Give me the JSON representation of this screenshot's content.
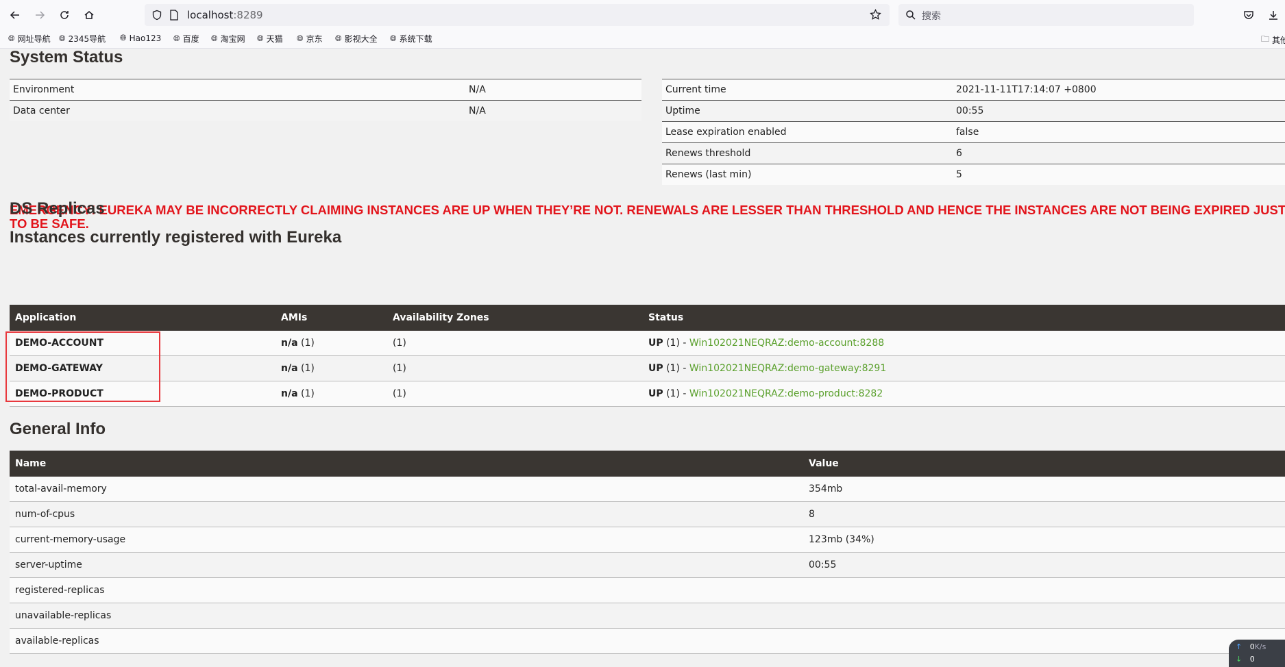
{
  "browser": {
    "url_host": "localhost",
    "url_port": ":8289",
    "search_placeholder": "搜索",
    "bookmarks": [
      "网址导航",
      "2345导航",
      "Hao123",
      "百度",
      "淘宝网",
      "天猫",
      "京东",
      "影视大全",
      "系统下载"
    ],
    "other_bookmarks": "其他"
  },
  "system_status": {
    "title": "System Status",
    "left_rows": [
      {
        "label": "Environment",
        "value": "N/A"
      },
      {
        "label": "Data center",
        "value": "N/A"
      }
    ],
    "right_rows": [
      {
        "label": "Current time",
        "value": "2021-11-11T17:14:07 +0800"
      },
      {
        "label": "Uptime",
        "value": "00:55"
      },
      {
        "label": "Lease expiration enabled",
        "value": "false"
      },
      {
        "label": "Renews threshold",
        "value": "6"
      },
      {
        "label": "Renews (last min)",
        "value": "5"
      }
    ]
  },
  "emergency_text": "EMERGENCY! EUREKA MAY BE INCORRECTLY CLAIMING INSTANCES ARE UP WHEN THEY’RE NOT. RENEWALS ARE LESSER THAN THRESHOLD AND HENCE THE INSTANCES ARE NOT BEING EXPIRED JUST TO BE SAFE.",
  "ds_replicas_title": "DS Replicas",
  "instances": {
    "title": "Instances currently registered with Eureka",
    "headers": [
      "Application",
      "AMIs",
      "Availability Zones",
      "Status"
    ],
    "rows": [
      {
        "app": "DEMO-ACCOUNT",
        "ami_bold": "n/a",
        "ami_count": "(1)",
        "zones": "(1)",
        "status_bold": "UP",
        "status_count": "(1) - ",
        "instance": "Win102021NEQRAZ:demo-account:8288"
      },
      {
        "app": "DEMO-GATEWAY",
        "ami_bold": "n/a",
        "ami_count": "(1)",
        "zones": "(1)",
        "status_bold": "UP",
        "status_count": "(1) - ",
        "instance": "Win102021NEQRAZ:demo-gateway:8291"
      },
      {
        "app": "DEMO-PRODUCT",
        "ami_bold": "n/a",
        "ami_count": "(1)",
        "zones": "(1)",
        "status_bold": "UP",
        "status_count": "(1) - ",
        "instance": "Win102021NEQRAZ:demo-product:8282"
      }
    ]
  },
  "general_info": {
    "title": "General Info",
    "headers": [
      "Name",
      "Value"
    ],
    "rows": [
      {
        "name": "total-avail-memory",
        "value": "354mb"
      },
      {
        "name": "num-of-cpus",
        "value": "8"
      },
      {
        "name": "current-memory-usage",
        "value": "123mb (34%)"
      },
      {
        "name": "server-uptime",
        "value": "00:55"
      },
      {
        "name": "registered-replicas",
        "value": ""
      },
      {
        "name": "unavailable-replicas",
        "value": ""
      },
      {
        "name": "available-replicas",
        "value": ""
      }
    ]
  },
  "net_widget": {
    "up": "0",
    "unit": "K/s",
    "down": "0"
  },
  "colors": {
    "emergency": "#e2141b",
    "header_bg": "#3a3632",
    "link_green": "#5aa02c",
    "highlight_box": "#e8383d"
  }
}
